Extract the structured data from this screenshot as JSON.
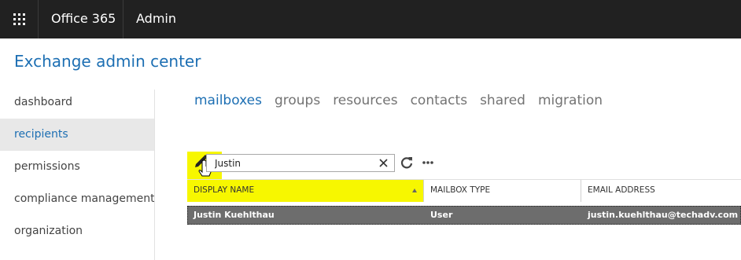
{
  "topbar": {
    "suite_name": "Office 365",
    "app_name": "Admin"
  },
  "page": {
    "title": "Exchange admin center"
  },
  "leftnav": {
    "items": [
      {
        "label": "dashboard"
      },
      {
        "label": "recipients"
      },
      {
        "label": "permissions"
      },
      {
        "label": "compliance management"
      },
      {
        "label": "organization"
      }
    ],
    "active": "recipients"
  },
  "tabs": {
    "items": [
      {
        "label": "mailboxes"
      },
      {
        "label": "groups"
      },
      {
        "label": "resources"
      },
      {
        "label": "contacts"
      },
      {
        "label": "shared"
      },
      {
        "label": "migration"
      }
    ],
    "active": "mailboxes"
  },
  "toolbar": {
    "search_value": "Justin",
    "edit_icon": "pencil-icon",
    "refresh_icon": "refresh-icon",
    "more_icon": "more-icon",
    "highlight_color": "#f7f700"
  },
  "table": {
    "columns": [
      {
        "label": "DISPLAY NAME"
      },
      {
        "label": "MAILBOX TYPE"
      },
      {
        "label": "EMAIL ADDRESS"
      }
    ],
    "rows": [
      {
        "display_name": "Justin Kuehlthau",
        "mailbox_type": "User",
        "email": "justin.kuehlthau@techadv.com",
        "selected": true
      }
    ]
  },
  "colors": {
    "topbar_bg": "#212121",
    "accent": "#1d6fb3",
    "selected_row_bg": "#6d6d6d"
  }
}
